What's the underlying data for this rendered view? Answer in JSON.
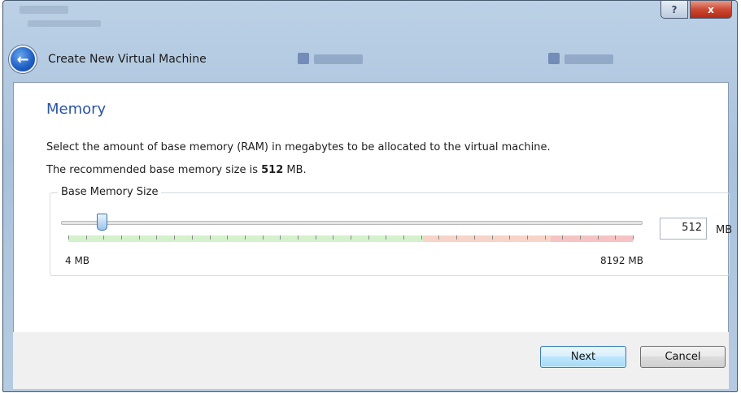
{
  "window": {
    "help_glyph": "?",
    "close_glyph": "x"
  },
  "wizard": {
    "back_icon": "back-arrow-icon",
    "title": "Create New Virtual Machine"
  },
  "page": {
    "title": "Memory",
    "description": "Select the amount of base memory (RAM) in megabytes to be allocated to the virtual machine.",
    "recommend_prefix": "The recommended base memory size is ",
    "recommend_value": "512",
    "recommend_unit": " MB."
  },
  "memory": {
    "group_label": "Base Memory Size",
    "min_label": "4 MB",
    "max_label": "8192 MB",
    "min_mb": 4,
    "max_mb": 8192,
    "value": "512",
    "unit": "MB",
    "range_colors": {
      "ok": "#d4f1cb",
      "warn": "#f7d4c8",
      "danger": "#f5c3c3"
    }
  },
  "buttons": {
    "next": "Next",
    "cancel": "Cancel"
  },
  "accent_color": "#2b55a6"
}
